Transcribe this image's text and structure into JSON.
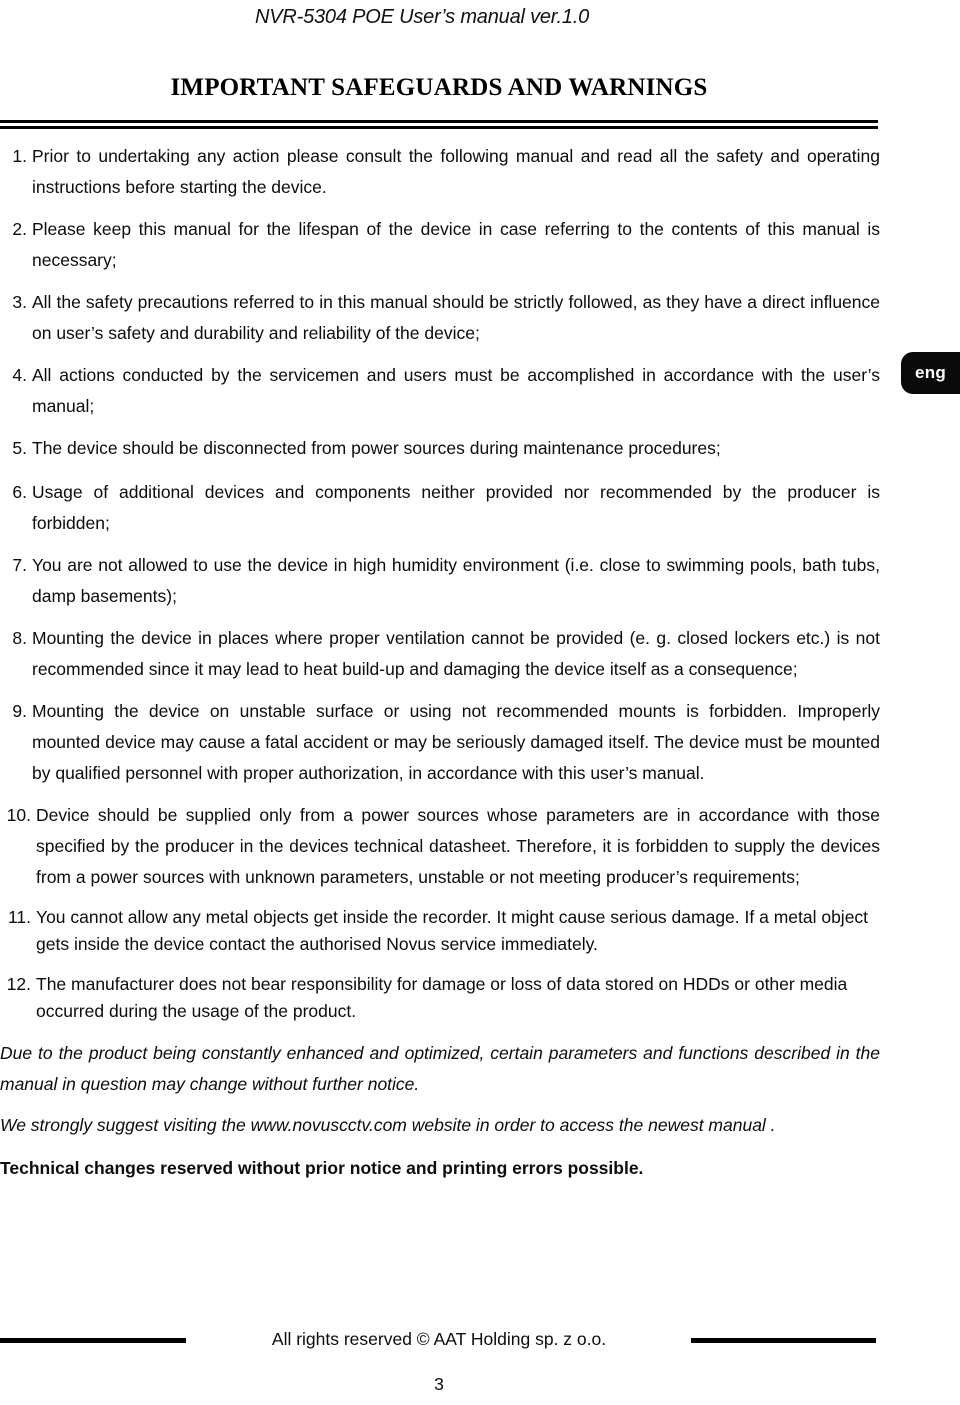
{
  "header": {
    "running_title": "NVR-5304 POE User’s manual ver.1.0"
  },
  "language_tab": {
    "label": "eng"
  },
  "section": {
    "title": "IMPORTANT SAFEGUARDS AND WARNINGS"
  },
  "safeguards": [
    {
      "number": "1.",
      "text": "Prior to undertaking any action please consult the following manual and read all the safety and operating instructions before starting the device."
    },
    {
      "number": "2.",
      "text": "Please keep this manual for the lifespan of the device in case referring to the contents of this manual is necessary;"
    },
    {
      "number": "3.",
      "text": "All the safety precautions referred to in this manual should be strictly followed, as they have a direct influence on user’s safety and durability and reliability of the device;"
    },
    {
      "number": "4.",
      "text": "All actions conducted by the servicemen and users must be accomplished in accordance with the user’s manual;"
    },
    {
      "number": "5.",
      "text": "The device should be disconnected from power sources during maintenance procedures;"
    },
    {
      "number": "6.",
      "text": "Usage of additional devices and components neither provided nor recommended by the producer is forbidden;"
    },
    {
      "number": "7.",
      "text": "You are not allowed to use the device in high humidity environment (i.e. close to swimming pools, bath tubs, damp basements);"
    },
    {
      "number": "8.",
      "text": "Mounting the device in places where proper ventilation cannot be provided (e. g. closed lockers etc.) is not recommended since it may lead to heat build-up and damaging the device itself as a consequence;"
    },
    {
      "number": "9.",
      "text": "Mounting the device on unstable surface or using not recommended mounts is forbidden. Improperly mounted device may cause a fatal accident or may be seriously damaged itself. The device must be mounted by qualified personnel with proper authorization, in accordance with this user’s manual."
    },
    {
      "number": "10.",
      "text": "Device should be supplied only from a power sources whose parameters are in accordance with those specified by the producer in the devices technical datasheet. Therefore, it is forbidden to supply the devices from a power sources with unknown parameters, unstable or not meeting producer’s requirements;"
    },
    {
      "number": "11.",
      "text": "You cannot allow any metal objects get inside the recorder. It might cause serious damage. If a metal object gets inside the device contact the authorised Novus service immediately."
    },
    {
      "number": "12.",
      "text": "The manufacturer does not bear responsibility for damage or loss of data stored on HDDs or other media occurred during the usage of the product."
    }
  ],
  "notes": {
    "note_1": "Due to the product being constantly enhanced and optimized, certain parameters and functions described in the manual in question may change without further notice.",
    "note_2": "We strongly suggest visiting the www.novuscctv.com website in order to access the newest manual .",
    "note_3": "Technical changes reserved without prior notice and printing errors possible."
  },
  "footer": {
    "copyright": "All rights reserved © AAT Holding sp. z o.o.",
    "page_number": "3"
  }
}
